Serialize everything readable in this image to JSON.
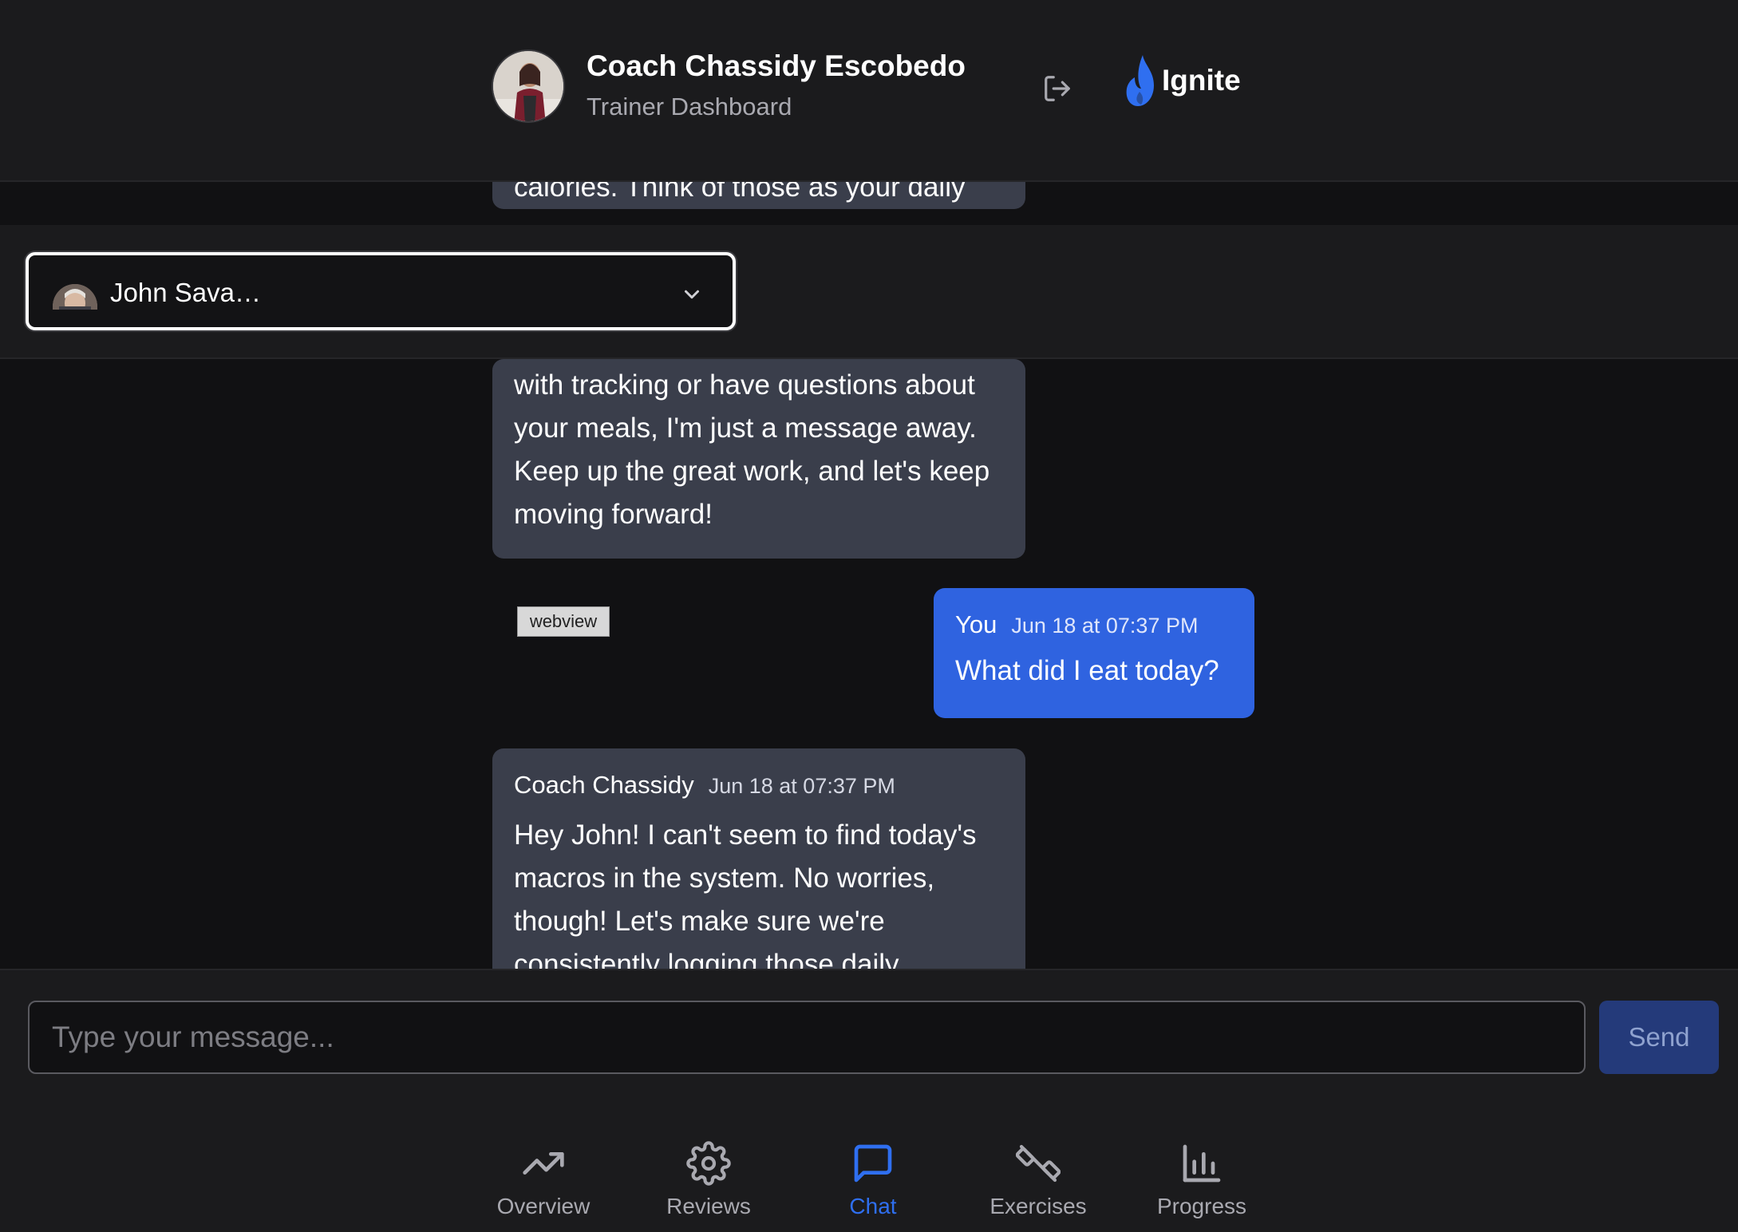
{
  "header": {
    "coach_name": "Coach Chassidy Escobedo",
    "subtitle": "Trainer Dashboard",
    "logout_icon": "logout-icon",
    "brand_name": "Ignite",
    "brand_color": "#2f6ff0"
  },
  "client_selector": {
    "selected_client": "John Sava…",
    "chevron_icon": "chevron-down-icon"
  },
  "messages": [
    {
      "sender": "coach",
      "visible_text": "calories. Think of those as your daily"
    },
    {
      "sender": "coach",
      "visible_text": "with tracking or have questions about your meals, I'm just a message away. Keep up the great work, and let's keep moving forward!"
    },
    {
      "sender": "you",
      "name": "You",
      "time": "Jun 18 at 07:37 PM",
      "text": "What did I eat today?"
    },
    {
      "sender": "coach",
      "name": "Coach Chassidy",
      "time": "Jun 18 at 07:37 PM",
      "text": "Hey John! I can't seem to find today's macros in the system. No worries, though! Let's make sure we're consistently logging those daily"
    }
  ],
  "webview_badge": "webview",
  "composer": {
    "placeholder": "Type your message...",
    "send_label": "Send"
  },
  "bottom_nav": {
    "items": [
      {
        "label": "Overview",
        "icon": "trending-up-icon",
        "active": false
      },
      {
        "label": "Reviews",
        "icon": "gear-icon",
        "active": false
      },
      {
        "label": "Chat",
        "icon": "chat-bubble-icon",
        "active": true
      },
      {
        "label": "Exercises",
        "icon": "dumbbell-icon",
        "active": false
      },
      {
        "label": "Progress",
        "icon": "bar-chart-icon",
        "active": false
      }
    ]
  },
  "colors": {
    "background": "#111113",
    "panel": "#1b1b1d",
    "incoming_bubble": "#3a3e4b",
    "outgoing_bubble": "#2f63e0",
    "accent": "#2f6ff0"
  }
}
